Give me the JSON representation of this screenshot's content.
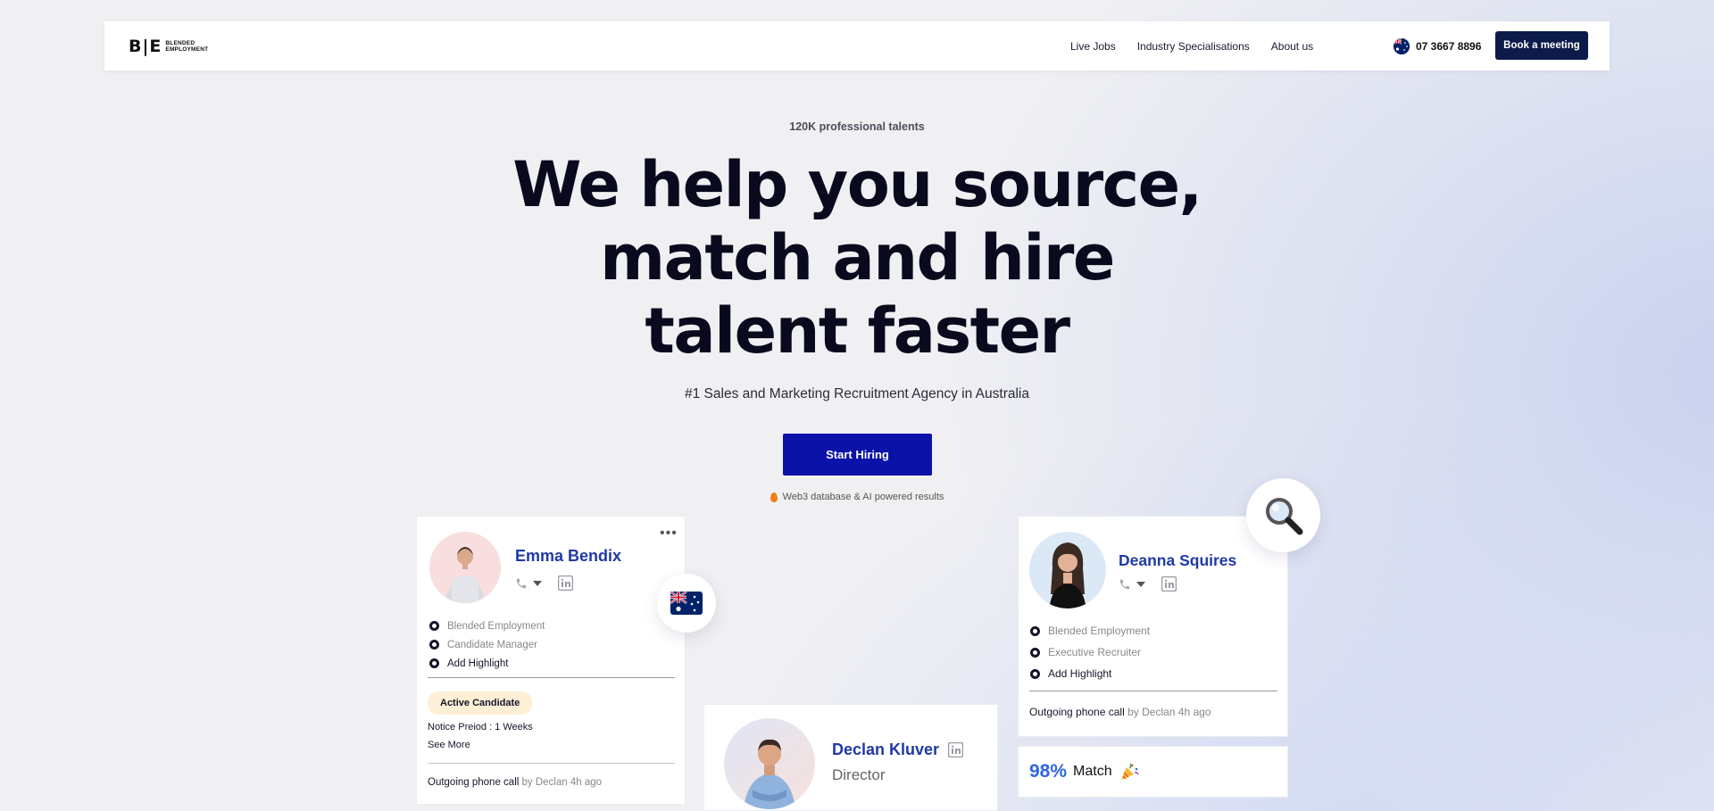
{
  "nav": {
    "logo_mark": "B|E",
    "logo_line1": "BLENDED",
    "logo_line2": "EMPLOYMENT",
    "links": [
      "Live Jobs",
      "Industry Specialisations",
      "About us"
    ],
    "phone": "07 3667 8896",
    "book_label": "Book a meeting"
  },
  "hero": {
    "eyebrow": "120K professional talents",
    "headline_lines": [
      "We help you source,",
      "match and hire",
      "talent faster"
    ],
    "subhead": "#1 Sales and Marketing Recruitment Agency in Australia",
    "cta": "Start Hiring",
    "powered": "Web3 database & AI powered results"
  },
  "cards": {
    "emma": {
      "name": "Emma Bendix",
      "bullets": [
        "Blended Employment",
        "Candidate Manager",
        "Add Highlight"
      ],
      "badge": "Active Candidate",
      "notice": "Notice Preiod : 1 Weeks",
      "see_more": "See More",
      "call_prefix": "Outgoing phone call",
      "call_meta": "by Declan 4h ago"
    },
    "deanna": {
      "name": "Deanna Squires",
      "bullets": [
        "Blended Employment",
        "Executive Recruiter",
        "Add Highlight"
      ],
      "call_prefix": "Outgoing phone call",
      "call_meta": "by Declan 4h ago"
    },
    "declan": {
      "name": "Declan Kluver",
      "title": "Director"
    },
    "match": {
      "percent": "98%",
      "word": "Match"
    }
  },
  "colors": {
    "navy": "#0d1b4b",
    "cta_blue": "#0b12a8",
    "name_blue": "#1f3aa6",
    "match_blue": "#2f66e0",
    "badge_bg": "#fdf0d5"
  }
}
